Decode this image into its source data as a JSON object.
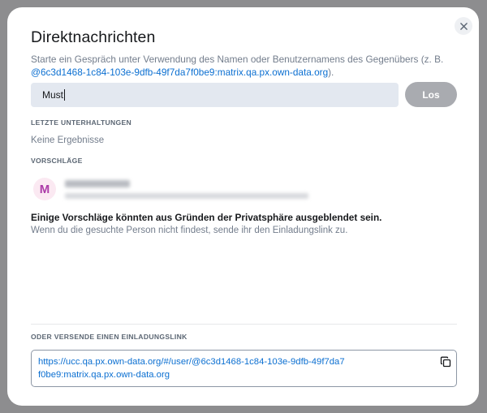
{
  "dialog": {
    "title": "Direktnachrichten",
    "description_prefix": "Starte ein Gespräch unter Verwendung des Namen oder Benutzernamens des Gegenübers (z. B.",
    "description_mxid": "@6c3d1468-1c84-103e-9dfb-49f7da7f0be9:matrix.qa.px.own-data.org",
    "description_suffix": ").",
    "close_icon": "close-icon"
  },
  "search": {
    "value": "Must",
    "go_label": "Los"
  },
  "recent": {
    "heading": "LETZTE UNTERHALTUNGEN",
    "empty_text": "Keine Ergebnisse"
  },
  "suggestions": {
    "heading": "VORSCHLÄGE",
    "items": [
      {
        "avatar_letter": "M",
        "avatar_color": "#ac3ba8",
        "avatar_bg": "#fbe9f2"
      }
    ]
  },
  "privacy": {
    "bold": "Einige Vorschläge könnten aus Gründen der Privatsphäre ausgeblendet sein.",
    "text": "Wenn du die gesuchte Person nicht findest, sende ihr den Einladungslink zu."
  },
  "invite": {
    "heading": "ODER VERSENDE EINEN EINLADUNGSLINK",
    "link": "https://ucc.qa.px.own-data.org/#/user/@6c3d1468-1c84-103e-9dfb-49f7da7f0be9:matrix.qa.px.own-data.org",
    "copy_icon": "copy-icon"
  },
  "colors": {
    "accent": "#0b6fd1",
    "button_disabled": "#a9abb0"
  }
}
